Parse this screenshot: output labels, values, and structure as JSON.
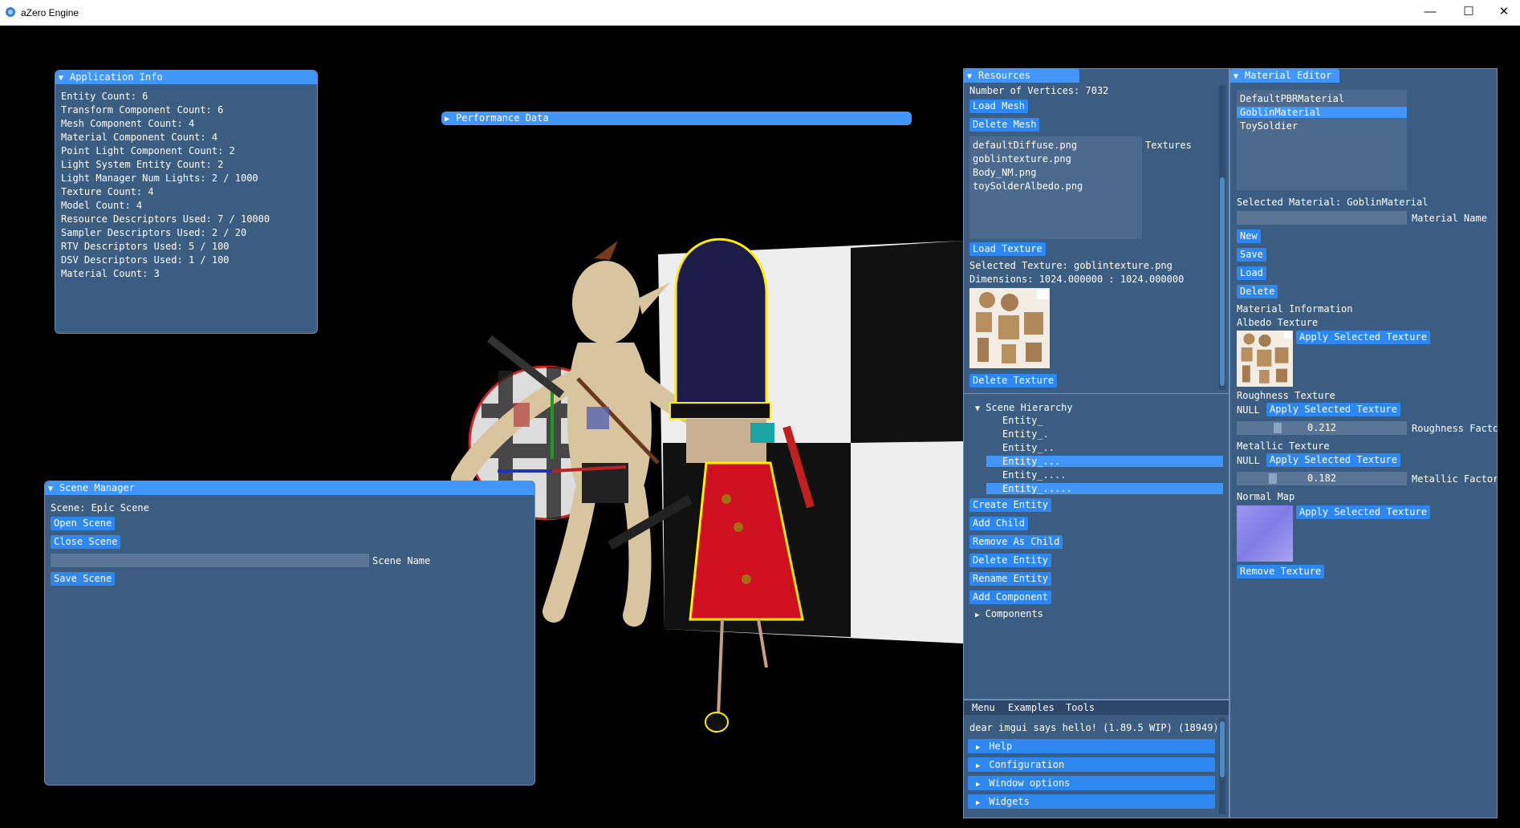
{
  "window": {
    "title": "aZero Engine",
    "min": "—",
    "max": "☐",
    "close": "✕"
  },
  "app_info": {
    "title": "Application Info",
    "lines": [
      "Entity Count: 6",
      "Transform Component Count: 6",
      "Mesh Component Count: 4",
      "Material Component Count: 4",
      "Point Light Component Count: 2",
      "Light System Entity Count: 2",
      "Light Manager Num Lights: 2 / 1000",
      "Texture Count: 4",
      "Model Count: 4",
      "Resource Descriptors Used: 7 / 10000",
      "Sampler Descriptors Used: 2 / 20",
      "RTV Descriptors Used: 5 / 100",
      "DSV Descriptors Used: 1 / 100",
      "Material Count: 3"
    ]
  },
  "performance": {
    "title": "Performance Data"
  },
  "scene_manager": {
    "title": "Scene Manager",
    "scene_label": "Scene: Epic Scene",
    "open": "Open Scene",
    "close": "Close Scene",
    "name_label": "Scene Name",
    "save": "Save Scene"
  },
  "resources": {
    "title": "Resources",
    "vertices": "Number of Vertices: 7032",
    "load_mesh": "Load Mesh",
    "delete_mesh": "Delete Mesh",
    "textures": [
      "defaultDiffuse.png",
      "goblintexture.png",
      "Body_NM.png",
      "toySolderAlbedo.png"
    ],
    "textures_label": "Textures",
    "load_texture": "Load Texture",
    "selected_texture": "Selected Texture: goblintexture.png",
    "dimensions": "Dimensions: 1024.000000 : 1024.000000",
    "delete_texture": "Delete Texture"
  },
  "hierarchy": {
    "title": "Scene Hierarchy",
    "entities": [
      "Entity_",
      "Entity_.",
      "Entity_..",
      "Entity_...",
      "Entity_....",
      "Entity_....."
    ],
    "create": "Create Entity",
    "add_child": "Add Child",
    "remove_child": "Remove As Child",
    "delete": "Delete Entity",
    "rename": "Rename Entity",
    "add_component": "Add Component",
    "components": "Components"
  },
  "demo": {
    "menu": [
      "Menu",
      "Examples",
      "Tools"
    ],
    "hello": "dear imgui says hello! (1.89.5 WIP) (18949)",
    "sections": [
      "Help",
      "Configuration",
      "Window options",
      "Widgets"
    ]
  },
  "material_editor": {
    "title": "Material Editor",
    "materials": [
      "DefaultPBRMaterial",
      "GoblinMaterial",
      "ToySoldier"
    ],
    "selected": "Selected Material: GoblinMaterial",
    "name_label": "Material Name",
    "new": "New",
    "save": "Save",
    "load": "Load",
    "delete": "Delete",
    "info": "Material Information",
    "albedo": "Albedo Texture",
    "apply": "Apply Selected Texture",
    "roughness": "Roughness Texture",
    "null": "NULL",
    "roughness_value": "0.212",
    "roughness_label": "Roughness Facto",
    "metallic": "Metallic Texture",
    "metallic_value": "0.182",
    "metallic_label": "Metallic Factor",
    "normal": "Normal Map",
    "remove": "Remove Texture"
  }
}
